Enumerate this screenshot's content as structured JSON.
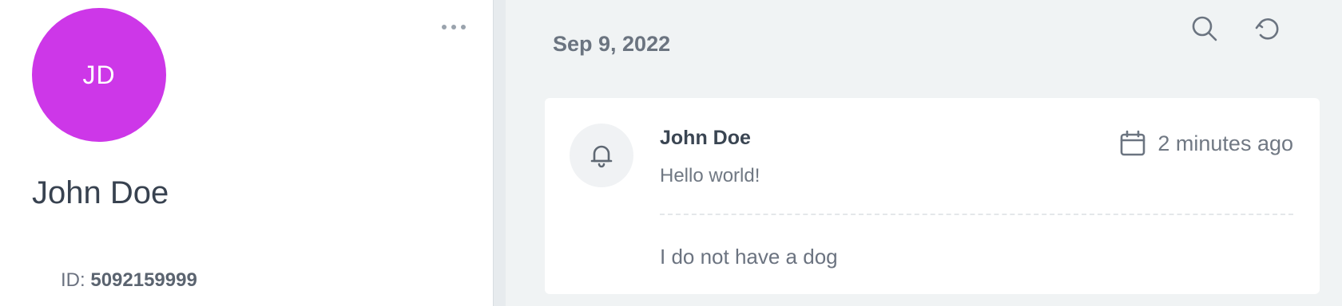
{
  "profile": {
    "initials": "JD",
    "avatar_color": "#cd37e8",
    "name": "John Doe",
    "id_label": "ID:",
    "id_value": "5092159999",
    "more_icon": "more-horizontal-icon"
  },
  "feed": {
    "date": "Sep 9, 2022",
    "toolbar": {
      "search_icon": "search-icon",
      "refresh_icon": "refresh-icon"
    },
    "items": [
      {
        "icon": "bell-icon",
        "sender": "John Doe",
        "title": "Hello world!",
        "time_icon": "calendar-icon",
        "time": "2 minutes ago",
        "body": "I do not have a dog"
      }
    ]
  },
  "colors": {
    "panel_bg": "#f0f3f4",
    "text_dark": "#384250",
    "text_muted": "#707883"
  }
}
